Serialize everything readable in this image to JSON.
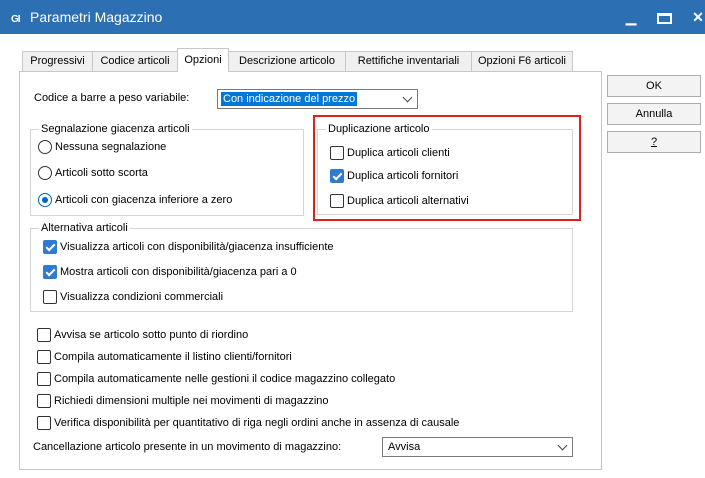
{
  "window": {
    "app_logo": "G",
    "app_logo_suffix": "I",
    "title": "Parametri Magazzino"
  },
  "tabs": [
    "Progressivi",
    "Codice articoli",
    "Opzioni",
    "Descrizione articolo",
    "Rettifiche inventariali",
    "Opzioni F6 articoli"
  ],
  "active_tab": "Opzioni",
  "side_buttons": {
    "ok": "OK",
    "annulla": "Annulla",
    "help": "?"
  },
  "barcode": {
    "label": "Codice a barre a peso variabile:",
    "value": "Con indicazione del prezzo"
  },
  "segnalazione": {
    "title": "Segnalazione giacenza articoli",
    "options": [
      {
        "label": "Nessuna segnalazione",
        "selected": false
      },
      {
        "label": "Articoli sotto scorta",
        "selected": false
      },
      {
        "label": "Articoli con giacenza inferiore a zero",
        "selected": true
      }
    ]
  },
  "duplicazione": {
    "title": "Duplicazione articolo",
    "options": [
      {
        "label": "Duplica articoli clienti",
        "checked": false
      },
      {
        "label": "Duplica articoli fornitori",
        "checked": true
      },
      {
        "label": "Duplica articoli alternativi",
        "checked": false
      }
    ]
  },
  "alternativa": {
    "title": "Alternativa articoli",
    "options": [
      {
        "label": "Visualizza articoli con disponibilità/giacenza insufficiente",
        "checked": true
      },
      {
        "label": "Mostra articoli con disponibilità/giacenza pari a 0",
        "checked": true
      },
      {
        "label": "Visualizza condizioni commerciali",
        "checked": false
      }
    ]
  },
  "general_options": [
    {
      "label": "Avvisa se articolo sotto punto di riordino",
      "checked": false
    },
    {
      "label": "Compila automaticamente il listino clienti/fornitori",
      "checked": false
    },
    {
      "label": "Compila automaticamente nelle gestioni il codice magazzino collegato",
      "checked": false
    },
    {
      "label": "Richiedi dimensioni multiple nei movimenti di magazzino",
      "checked": false
    },
    {
      "label": "Verifica disponibilità per quantitativo di riga negli ordini anche in assenza di causale",
      "checked": false
    }
  ],
  "cancellazione": {
    "label": "Cancellazione articolo presente in un movimento di magazzino:",
    "value": "Avvisa"
  }
}
